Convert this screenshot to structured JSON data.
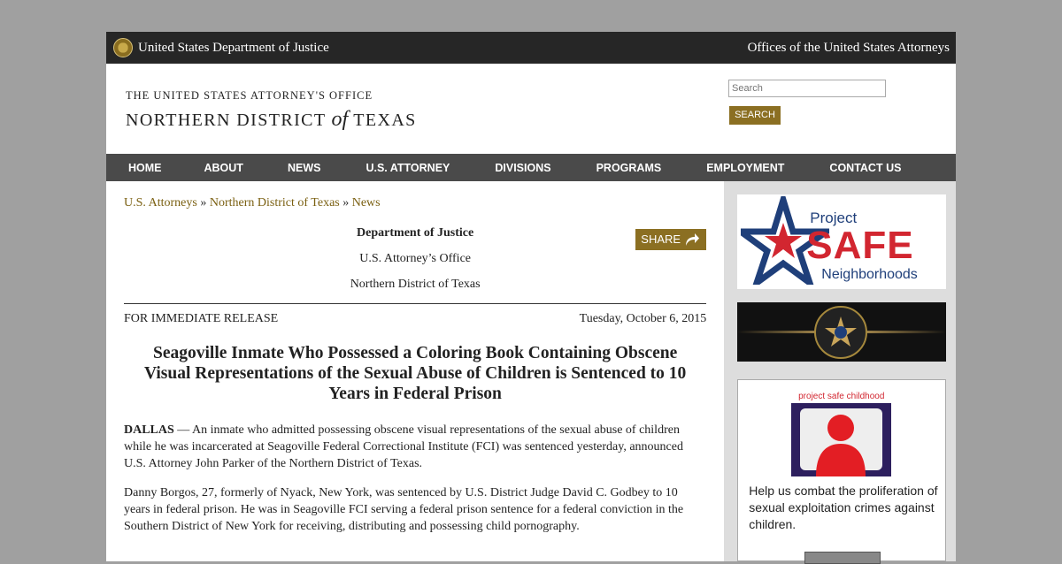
{
  "topbar": {
    "doj": "United States Department of Justice",
    "usao": "Offices of the United States Attorneys"
  },
  "header": {
    "office_line1": "THE UNITED STATES ATTORNEY'S OFFICE",
    "office_line2a": "NORTHERN DISTRICT",
    "office_of": "of",
    "office_line2b": "TEXAS",
    "search_placeholder": "Search",
    "search_button": "SEARCH"
  },
  "nav": [
    "HOME",
    "ABOUT",
    "NEWS",
    "U.S. ATTORNEY",
    "DIVISIONS",
    "PROGRAMS",
    "EMPLOYMENT",
    "CONTACT US"
  ],
  "breadcrumb": {
    "a": "U.S. Attorneys",
    "sep": " » ",
    "b": "Northern District of Texas",
    "c": "News"
  },
  "press": {
    "dept": "Department of Justice",
    "office": "U.S. Attorney’s Office",
    "district": "Northern District of Texas",
    "share": "SHARE",
    "release": "FOR IMMEDIATE RELEASE",
    "date": "Tuesday, October 6, 2015",
    "headline": "Seagoville Inmate Who Possessed a Coloring Book Containing Obscene Visual Representations of the Sexual Abuse of Children is Sentenced to 10 Years in Federal Prison",
    "dateline": "DALLAS",
    "p1": " — An inmate who admitted possessing obscene visual representations of the sexual abuse of children while he was incarcerated at Seagoville Federal Correctional Institute (FCI) was sentenced yesterday, announced U.S. Attorney John Parker of the Northern District of Texas.",
    "p2": "Danny Borgos, 27, formerly of Nyack, New York, was sentenced by U.S. District Judge David C. Godbey to 10 years in federal prison.  He was in Seagoville FCI serving a federal prison sentence for a federal conviction in the Southern District of New York for receiving, distributing and possessing child pornography."
  },
  "sidebar": {
    "psn_project": "Project",
    "psn_safe": "SAFE",
    "psn_neighborhoods": "Neighborhoods",
    "psc_title": "project safe childhood",
    "psc_text": "Help us combat the proliferation of sexual exploitation crimes against children.",
    "colors": {
      "psn_red": "#d22630",
      "psn_blue": "#1f3f7a",
      "gold": "#8b6f22"
    }
  }
}
